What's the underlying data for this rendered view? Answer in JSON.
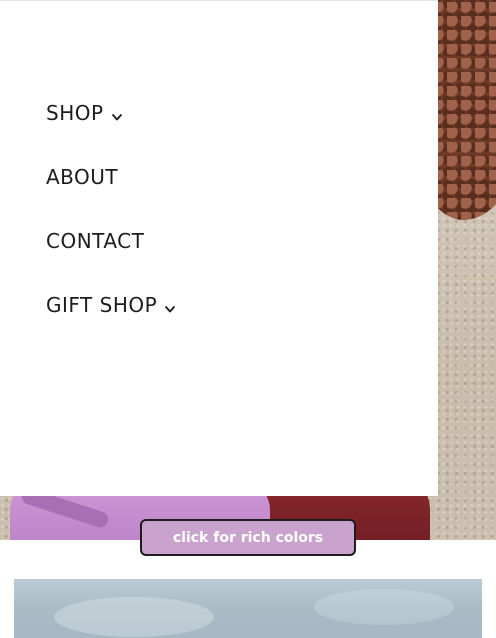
{
  "menu": {
    "items": [
      {
        "label": "SHOP",
        "has_dropdown": true,
        "icon": "chevron-down-icon"
      },
      {
        "label": "ABOUT",
        "has_dropdown": false
      },
      {
        "label": "CONTACT",
        "has_dropdown": false
      },
      {
        "label": "GIFT SHOP",
        "has_dropdown": true,
        "icon": "chevron-down-icon"
      }
    ]
  },
  "cta": {
    "label": "click for rich colors",
    "background_color": "#c9a3cd",
    "text_color": "#ffffff",
    "border_color": "#1d1d1d"
  },
  "colors": {
    "drawer_background": "#ffffff",
    "menu_text": "#1d1d1d"
  }
}
